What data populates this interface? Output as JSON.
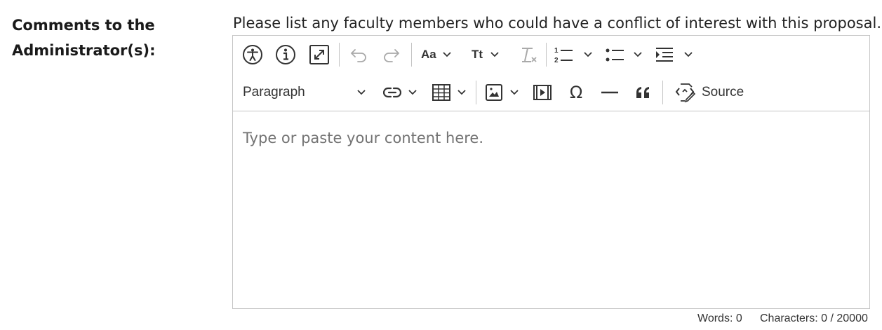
{
  "field": {
    "label": "Comments to the Administrator(s):",
    "help_text": "Please list any faculty members who could have a conflict of interest with this proposal."
  },
  "editor": {
    "placeholder": "Type or paste your content here.",
    "toolbar": {
      "heading_select": "Paragraph",
      "source_label": "Source",
      "font_size_label": "Aa",
      "text_case_label": "Tt",
      "icons": [
        "accessibility-icon",
        "info-icon",
        "fullscreen-icon",
        "undo-icon",
        "redo-icon",
        "font-size-icon",
        "text-case-icon",
        "remove-format-icon",
        "numbered-list-icon",
        "bulleted-list-icon",
        "indent-icon",
        "link-icon",
        "table-icon",
        "image-icon",
        "media-icon",
        "special-characters-icon",
        "horizontal-line-icon",
        "blockquote-icon",
        "source-icon"
      ]
    },
    "status": {
      "words": "Words: 0",
      "characters": "Characters: 0 / 20000"
    }
  }
}
